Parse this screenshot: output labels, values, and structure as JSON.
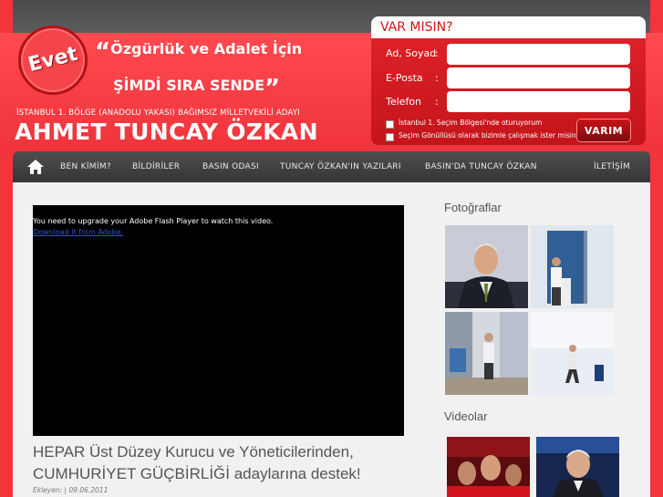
{
  "header": {
    "stamp": "Evet",
    "slogan_line1": "Özgürlük ve Adalet İçin",
    "slogan_line2": "ŞİMDİ SIRA SENDE",
    "open_quote": "“",
    "close_quote": "”",
    "subtitle": "İSTANBUL 1. BÖLGE (ANADOLU YAKASI) BAĞIMSIZ MİLLETVEKİLİ ADAYI",
    "name": "AHMET TUNCAY ÖZKAN"
  },
  "form": {
    "title": "VAR MISIN?",
    "fields": [
      {
        "label": "Ad, Soyad",
        "value": ""
      },
      {
        "label": "E-Posta",
        "value": ""
      },
      {
        "label": "Telefon",
        "value": ""
      }
    ],
    "colon": ":",
    "checkboxes": [
      {
        "label": "İstanbul 1. Seçim Bölgesi'nde oturuyorum",
        "checked": false
      },
      {
        "label": "Seçim Gönüllüsü olarak bizimle çalışmak ister misiniz?",
        "checked": false
      }
    ],
    "submit": "VARIM"
  },
  "nav": {
    "home_icon": "home-icon",
    "items": [
      "BEN KİMİM?",
      "BİLDİRİLER",
      "BASIN ODASI",
      "TUNCAY ÖZKAN'IN YAZILARI",
      "BASIN'DA TUNCAY ÖZKAN",
      "İLETİŞİM"
    ]
  },
  "main": {
    "flash_message": "You need to upgrade your Adobe Flash Player to watch this video.",
    "flash_link": "Download it from Adobe.",
    "video_title": "HEPAR Üst Düzey Kurucu ve Yöneticilerinden, CUMHURİYET GÜÇBİRLİĞİ adaylarına destek!",
    "meta": "Ekleyen: | 09.06.2011"
  },
  "sidebar": {
    "photos_title": "Fotoğraflar",
    "videos_title": "Videolar"
  },
  "colors": {
    "brand_red": "#f2353b",
    "nav_dark": "#3f3f3f",
    "content_bg": "#f1f1f1"
  }
}
